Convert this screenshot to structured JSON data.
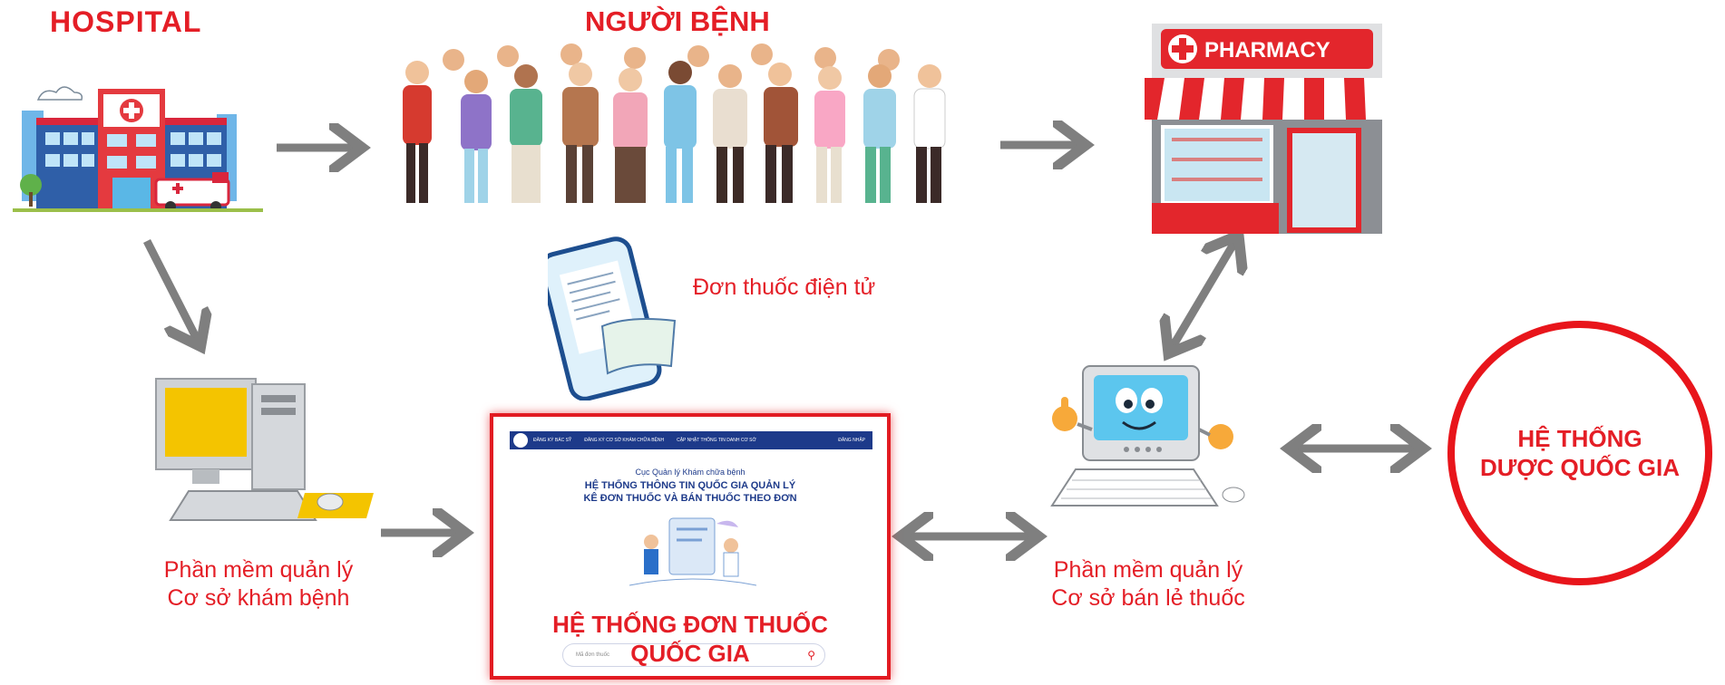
{
  "labels": {
    "hospital": "HOSPITAL",
    "patients": "NGƯỜI BỆNH",
    "pharmacy_sign": "PHARMACY",
    "e_prescription": "Đơn thuốc điện tử",
    "clinic_software_line1": "Phần mềm quản lý",
    "clinic_software_line2": "Cơ sở khám bệnh",
    "retail_software_line1": "Phần mềm quản lý",
    "retail_software_line2": "Cơ sở bán lẻ thuốc",
    "national_pharma_line1": "HỆ THỐNG",
    "national_pharma_line2": "DƯỢC QUỐC GIA",
    "national_rx_line1": "HỆ THỐNG ĐƠN THUỐC",
    "national_rx_line2": "QUỐC GIA"
  },
  "screenshot": {
    "nav": [
      "ĐĂNG KÝ BÁC SỸ",
      "ĐĂNG KÝ CƠ SỞ KHÁM CHỮA BỆNH",
      "CẬP NHẬT THÔNG TIN DANH CƠ SỞ"
    ],
    "login": "ĐĂNG NHẬP",
    "agency": "Cục Quản lý Khám chữa bệnh",
    "headline_1": "HỆ THỐNG THÔNG TIN QUỐC GIA QUẢN LÝ",
    "headline_2": "KÊ ĐƠN THUỐC VÀ BÁN THUỐC THEO ĐƠN",
    "search_placeholder": "Mã đơn thuốc"
  },
  "colors": {
    "accent_red": "#e41e26",
    "arrow_gray": "#7f7f7f",
    "portal_blue": "#1d3a8a"
  }
}
